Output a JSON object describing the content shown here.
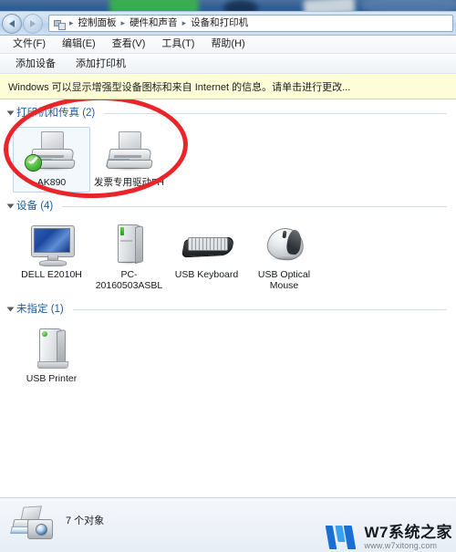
{
  "window": {
    "nav": {
      "back_label": "后退",
      "forward_label": "前进",
      "breadcrumb_icon": "control-panel-icon",
      "breadcrumbs": [
        "控制面板",
        "硬件和声音",
        "设备和打印机"
      ],
      "separator": "▸"
    },
    "menubar": [
      {
        "label": "文件(F)"
      },
      {
        "label": "编辑(E)"
      },
      {
        "label": "查看(V)"
      },
      {
        "label": "工具(T)"
      },
      {
        "label": "帮助(H)"
      }
    ],
    "toolbar": [
      {
        "label": "添加设备"
      },
      {
        "label": "添加打印机"
      }
    ],
    "infobar": {
      "text": "Windows 可以显示增强型设备图标和来自 Internet 的信息。请单击进行更改..."
    }
  },
  "groups": [
    {
      "title": "打印机和传真 (2)",
      "items": [
        {
          "label": "AK890",
          "icon": "printer-icon",
          "selected": true,
          "default_badge": "green-check-icon"
        },
        {
          "label": "发票专用驱动FH",
          "icon": "printer-icon",
          "selected": false
        }
      ]
    },
    {
      "title": "设备 (4)",
      "items": [
        {
          "label": "DELL E2010H",
          "icon": "monitor-icon"
        },
        {
          "label": "PC-20160503ASBL",
          "icon": "computer-tower-icon"
        },
        {
          "label": "USB Keyboard",
          "icon": "keyboard-icon"
        },
        {
          "label": "USB Optical Mouse",
          "icon": "mouse-icon"
        }
      ]
    },
    {
      "title": "未指定 (1)",
      "items": [
        {
          "label": "USB Printer",
          "icon": "usb-printer-icon"
        }
      ]
    }
  ],
  "annotation": {
    "shape": "red-ellipse-highlight",
    "color": "#e8262a"
  },
  "statusbar": {
    "icon": "devices-preview-icon",
    "text": "7 个对象"
  },
  "watermark": {
    "title": "W7系统之家",
    "url": "www.w7xitong.com",
    "logo": "w7-logo-icon"
  }
}
